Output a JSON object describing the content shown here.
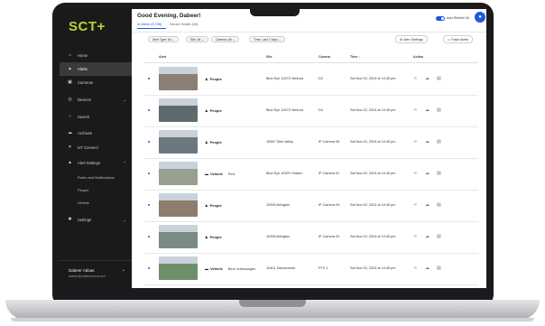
{
  "app": {
    "logo": "SCT+"
  },
  "sidebar": {
    "items": [
      {
        "label": "Home",
        "icon": "home-icon",
        "glyph": "⌂"
      },
      {
        "label": "Alerts",
        "icon": "bell-icon",
        "glyph": "▲"
      },
      {
        "label": "Cameras",
        "icon": "camera-icon",
        "glyph": "▣"
      },
      {
        "label": "Devices",
        "icon": "devices-icon",
        "glyph": "◎"
      },
      {
        "label": "Search",
        "icon": "search-icon",
        "glyph": "○"
      },
      {
        "label": "Archives",
        "icon": "cloud-icon",
        "glyph": "☁"
      },
      {
        "label": "IoT Connect",
        "icon": "star-icon",
        "glyph": "✶"
      },
      {
        "label": "Alert Settings",
        "icon": "alert-settings-icon",
        "glyph": "▲"
      },
      {
        "label": "Settings",
        "icon": "gear-icon",
        "glyph": "✱"
      }
    ],
    "subitems": [
      "Rules and Notifications",
      "People",
      "Vehicle"
    ],
    "user": {
      "name": "Dabeer Abbas",
      "email": "dabeer@smartcamera.com"
    }
  },
  "header": {
    "greeting": "Good Evening, Dabeer!",
    "tabs": [
      "AI Alerts (6,785)",
      "Device Health (26)"
    ],
    "auto_refresh_label": "Auto Refresh On",
    "auto_refresh_on": true
  },
  "filters": [
    "Alert Type: All",
    "Site: All",
    "Camera: All",
    "Time: Last 7 days"
  ],
  "buttons": {
    "alert_settings": "Alert Settings",
    "false_alerts": "False Alerts"
  },
  "table": {
    "columns": [
      "Alert",
      "Site",
      "Camera",
      "Time",
      "Action"
    ],
    "rows": [
      {
        "type": "People",
        "extra": "",
        "site": "Blue Eye 10570 Ventura",
        "camera": "D2",
        "time": "Sat Nov 02, 2024 at 10:45 pm",
        "thumb_color": "#8a7f72"
      },
      {
        "type": "People",
        "extra": "",
        "site": "Blue Eye 10570 Ventura",
        "camera": "D4",
        "time": "Sat Nov 02, 2024 at 10:45 pm",
        "thumb_color": "#5f6a6f"
      },
      {
        "type": "People",
        "extra": "",
        "site": "10567 Simi Valley",
        "camera": "IP Camera 05",
        "time": "Sat Nov 02, 2024 at 10:45 pm",
        "thumb_color": "#6d7780"
      },
      {
        "type": "Vehicle",
        "extra": "Red",
        "site": "Blue Eye 10320 Ontario",
        "camera": "IP Camera 01",
        "time": "Sat Nov 02, 2024 at 10:45 pm",
        "thumb_color": "#9aa08f"
      },
      {
        "type": "People",
        "extra": "",
        "site": "10395 Arlington",
        "camera": "IP Camera 04",
        "time": "Sat Nov 02, 2024 at 10:45 pm",
        "thumb_color": "#8c7d6c"
      },
      {
        "type": "People",
        "extra": "",
        "site": "10395 Arlington",
        "camera": "IP Camera 02",
        "time": "Sat Nov 02, 2024 at 10:45 pm",
        "thumb_color": "#7b8a84"
      },
      {
        "type": "Vehicle",
        "extra": "Blue Volkswagen",
        "site": "10401 Sacramento",
        "camera": "PTZ 1",
        "time": "Sat Nov 02, 2024 at 10:45 pm",
        "thumb_color": "#6f8e6a"
      }
    ]
  },
  "colors": {
    "accent": "#1d5bd6",
    "logo": "#b6d633",
    "sidebar_bg": "#1a1a1a"
  }
}
